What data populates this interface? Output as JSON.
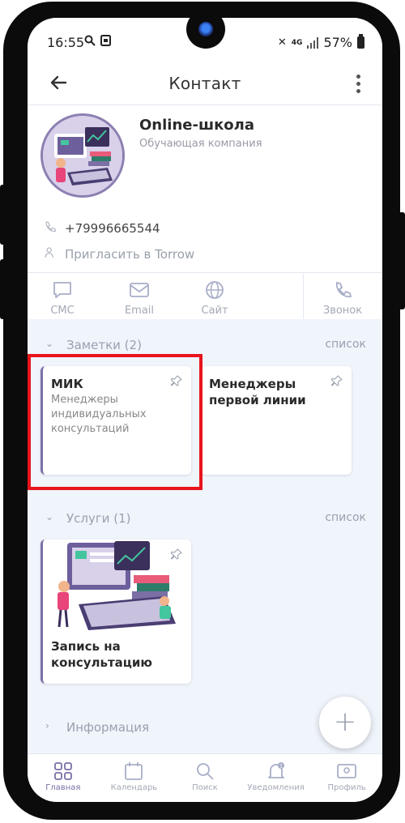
{
  "status_bar": {
    "time": "16:55",
    "battery": "57%",
    "network": "4G"
  },
  "header": {
    "title": "Контакт"
  },
  "profile": {
    "name": "Online-школа",
    "subtitle": "Обучающая компания",
    "phone": "+79996665544",
    "invite": "Пригласить в Torrow"
  },
  "actions": [
    {
      "label": "СМС",
      "icon": "chat-icon"
    },
    {
      "label": "Email",
      "icon": "mail-icon"
    },
    {
      "label": "Сайт",
      "icon": "globe-icon"
    },
    {
      "label": "Звонок",
      "icon": "phone-icon"
    }
  ],
  "notes": {
    "title": "Заметки (2)",
    "list_label": "список",
    "items": [
      {
        "title": "МИК",
        "body": "Менеджеры индивидуальных консультаций"
      },
      {
        "title": "Менеджеры первой линии",
        "body": ""
      }
    ]
  },
  "services": {
    "title": "Услуги (1)",
    "list_label": "список",
    "items": [
      {
        "title": "Запись на консультацию"
      }
    ]
  },
  "info": {
    "title": "Информация"
  },
  "fab": {
    "label": "+"
  },
  "bottom_nav": [
    {
      "label": "Главная",
      "icon": "grid-icon",
      "active": true
    },
    {
      "label": "Календарь",
      "icon": "calendar-icon",
      "active": false
    },
    {
      "label": "Поиск",
      "icon": "search-icon",
      "active": false
    },
    {
      "label": "Уведомления",
      "icon": "bell-icon",
      "active": false
    },
    {
      "label": "Профиль",
      "icon": "profile-card-icon",
      "active": false
    }
  ],
  "colors": {
    "accent": "#7b6fa6",
    "highlight": "#e8141c",
    "background": "#f0f4fb"
  }
}
